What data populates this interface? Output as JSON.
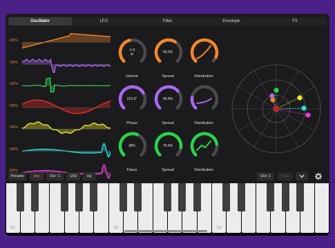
{
  "tabs": [
    "Oscillator",
    "LFO",
    "Filter",
    "Envelope",
    "FX"
  ],
  "active_tab": "Oscillator",
  "waves": [
    {
      "pct": "100%",
      "color": "#f2872a",
      "shape": "saw"
    },
    {
      "pct": "100%",
      "color": "#a867f0",
      "shape": "noisy"
    },
    {
      "pct": "100%",
      "color": "#28d44a",
      "shape": "spike"
    },
    {
      "pct": "100%",
      "color": "#ec2f2a",
      "shape": "sine"
    },
    {
      "pct": "100%",
      "color": "#efe92c",
      "shape": "wobble"
    },
    {
      "pct": "100%",
      "color": "#28e0df",
      "shape": "flat-spike"
    },
    {
      "pct": "100%",
      "color": "#e23fd8",
      "shape": "flat-spike"
    }
  ],
  "knobs": [
    {
      "label": "Detune",
      "value": "-1.5\nst",
      "color": "#f2872a",
      "level": 0.45
    },
    {
      "label": "Spread",
      "value": "43.0%",
      "color": "#f2872a",
      "level": 0.62
    },
    {
      "label": "Distribution",
      "value": "",
      "color": "#f2872a",
      "level": 0.92,
      "graph": "curve"
    },
    {
      "label": "Phase",
      "value": "214.3°",
      "color": "#a867f0",
      "level": 0.72
    },
    {
      "label": "Spread",
      "value": "49.6%",
      "color": "#a867f0",
      "level": 0.68
    },
    {
      "label": "Distribution",
      "value": "",
      "color": "#a867f0",
      "level": 0.2,
      "graph": "curve2"
    },
    {
      "label": "Flavor",
      "value": "38%",
      "color": "#28d44a",
      "level": 0.58
    },
    {
      "label": "Spread",
      "value": "79.6%",
      "color": "#28d44a",
      "level": 0.86
    },
    {
      "label": "Distribution",
      "value": "",
      "color": "#28d44a",
      "level": 0.8,
      "graph": "zigzag"
    }
  ],
  "toolbar": {
    "presets": "Presets",
    "arp": "Arp",
    "oct_left": "Oct: 1",
    "rate": "1/16",
    "direction": "Up",
    "oct_right": "Oct: 1",
    "hold": "Hold",
    "chevron": "chevron-down-icon",
    "gear": "gear-icon"
  },
  "keyboard": {
    "labels": [
      "C1",
      "C2",
      "C3"
    ]
  }
}
